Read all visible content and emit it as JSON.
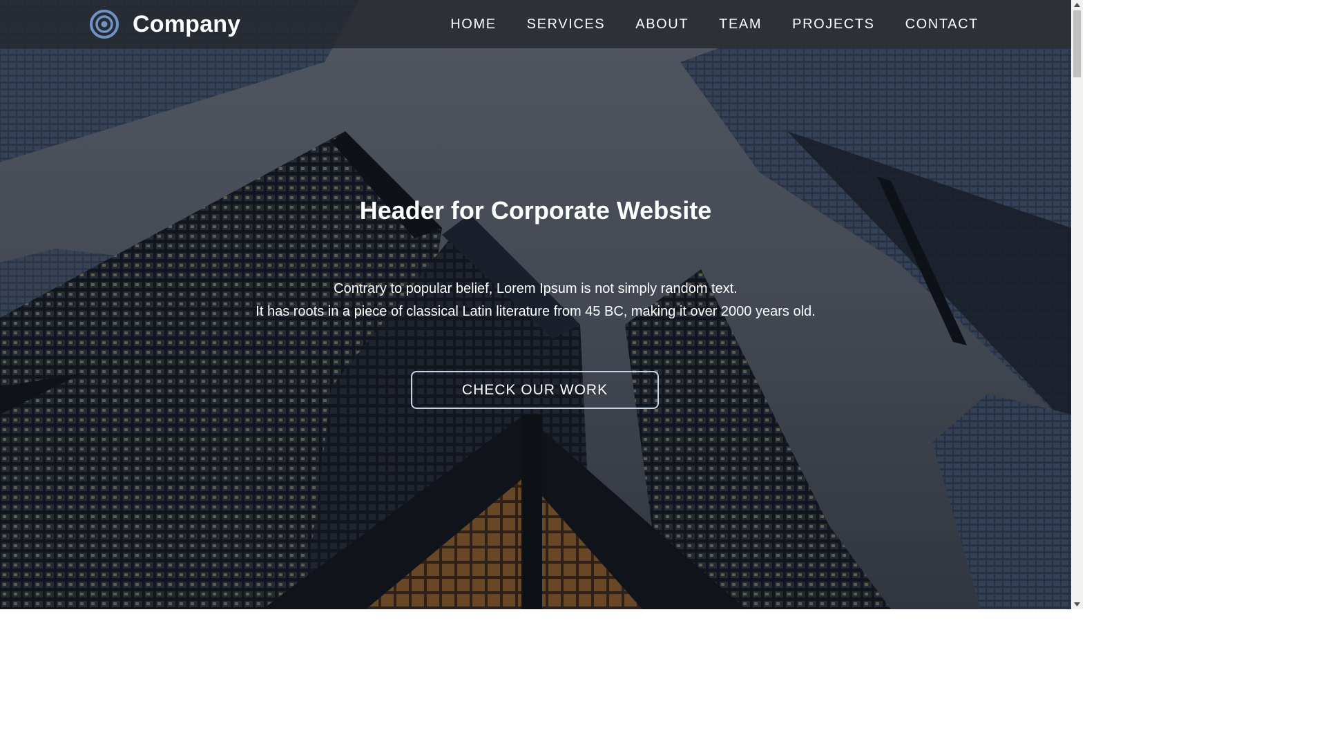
{
  "brand": {
    "name": "Company",
    "logo_icon": "concentric-target-icon",
    "logo_color": "#6f93c4"
  },
  "nav": {
    "items": [
      {
        "label": "HOME"
      },
      {
        "label": "SERVICES"
      },
      {
        "label": "ABOUT"
      },
      {
        "label": "TEAM"
      },
      {
        "label": "PROJECTS"
      },
      {
        "label": "CONTACT"
      }
    ]
  },
  "hero": {
    "title": "Header for Corporate Website",
    "text_lines": [
      "Contrary to popular belief, Lorem Ipsum is not simply random text.",
      "It has roots in a piece of classical Latin literature from 45 BC, making it over 2000 years old."
    ],
    "cta_label": "CHECK OUR WORK",
    "cta_border_color": "#c9d3e6",
    "background_description_icon": "skyscrapers-background"
  },
  "colors": {
    "navbar_bg": "#26282e",
    "text": "#ffffff",
    "sky": "#5b6270"
  }
}
